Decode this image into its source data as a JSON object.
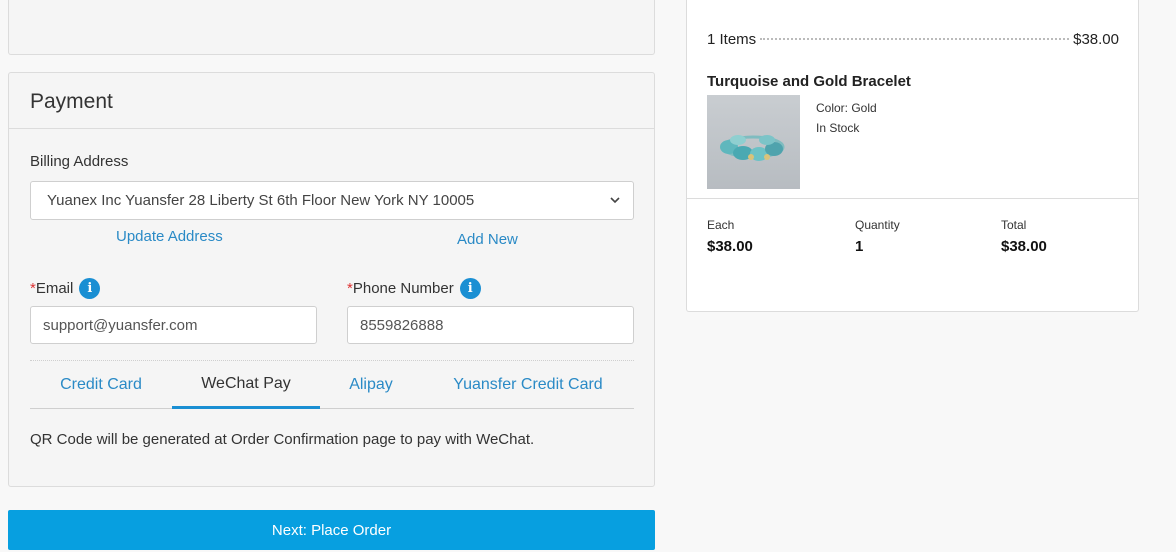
{
  "payment": {
    "title": "Payment",
    "billing_label": "Billing Address",
    "billing_address": "Yuanex Inc Yuansfer 28 Liberty St 6th Floor New York NY 10005",
    "update_address": "Update Address",
    "add_new": "Add New",
    "email_label": "Email",
    "phone_label": "Phone Number",
    "required_mark": "*",
    "info_glyph": "i",
    "email_value": "support@yuansfer.com",
    "phone_value": "8559826888",
    "tabs": [
      "Credit Card",
      "WeChat Pay",
      "Alipay",
      "Yuansfer Credit Card"
    ],
    "active_tab": "WeChat Pay",
    "qr_note": "QR Code will be generated at Order Confirmation page to pay with WeChat."
  },
  "next_button": "Next: Place Order",
  "summary": {
    "items_label": "1 Items",
    "items_total": "$38.00",
    "product_name": "Turquoise and Gold Bracelet",
    "color": "Color: Gold",
    "stock": "In Stock",
    "each_label": "Each",
    "each_value": "$38.00",
    "qty_label": "Quantity",
    "qty_value": "1",
    "total_label": "Total",
    "total_value": "$38.00"
  },
  "colors": {
    "accent": "#079fe0",
    "link": "#2a8ac6",
    "required": "#d33333"
  }
}
